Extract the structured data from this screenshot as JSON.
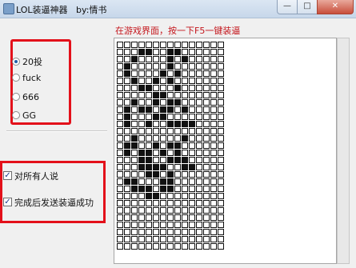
{
  "window": {
    "title": "LOL装逼神器   by:情书",
    "min_label": "—",
    "max_label": "□",
    "close_label": "✕"
  },
  "instruction": "在游戏界面，按一下F5一键装逼",
  "radio_options": [
    {
      "label": "20投",
      "selected": true
    },
    {
      "label": "fuck",
      "selected": false
    },
    {
      "label": "666",
      "selected": false
    },
    {
      "label": "GG",
      "selected": false
    }
  ],
  "checkboxes": [
    {
      "label": "对所有人说",
      "checked": true
    },
    {
      "label": "完成后发送装逼成功",
      "checked": true
    }
  ],
  "check_mark": "✓",
  "grid_pattern": [
    "00000000000000",
    "00011001100000",
    "00100001010000",
    "01000001000000",
    "01000010100000",
    "00100101000000",
    "00011000100000",
    "00000110000000",
    "00100101100000",
    "01011011010000",
    "01000110000000",
    "01001001111000",
    "00000000000000",
    "00100000010000",
    "01100101100000",
    "01011010100000",
    "00011001110000",
    "00011110011000",
    "00001101000000",
    "01100011000000",
    "00111011000000",
    "00001100000000",
    "00000000000000",
    "00000000000000",
    "00000000000000",
    "00000000000000",
    "00000000000000",
    "00000000000000",
    "00000000000000"
  ],
  "grid_last_partial_rows": 29
}
